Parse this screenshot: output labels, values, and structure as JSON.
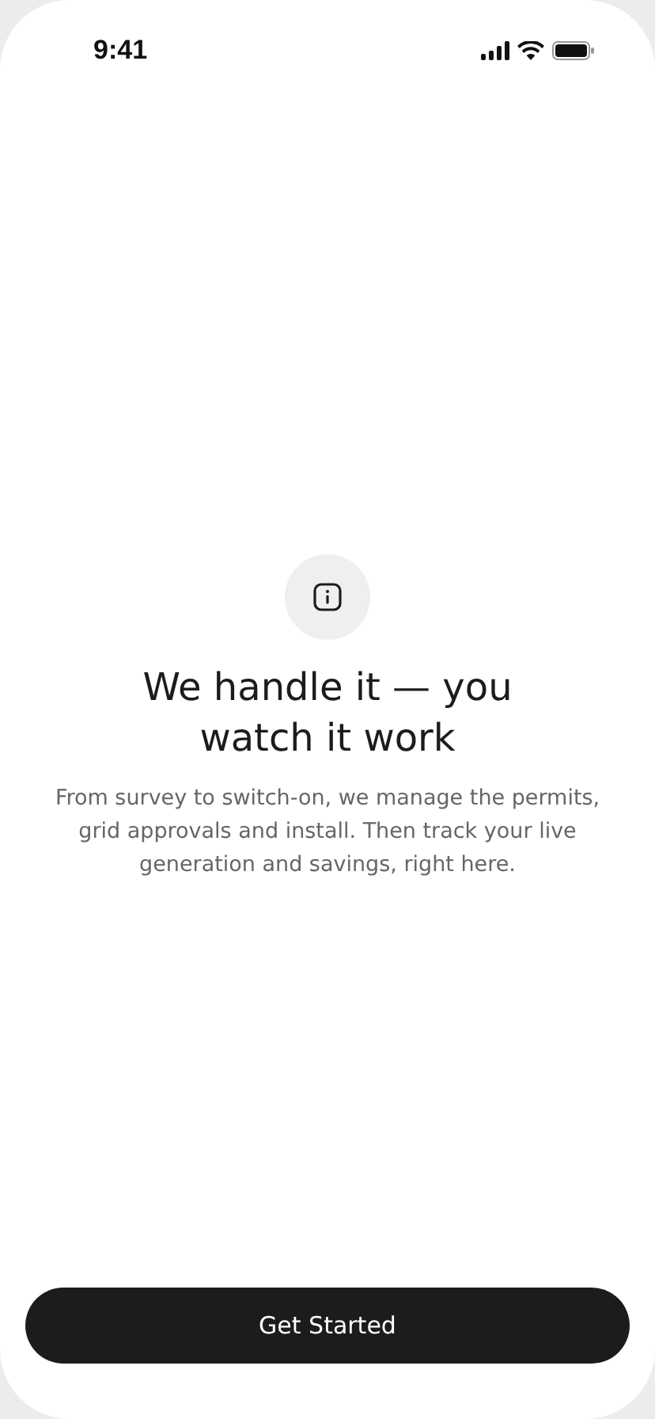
{
  "status_bar": {
    "time": "9:41"
  },
  "content": {
    "title": "We handle it — you watch it work",
    "body": "From survey to switch-on, we manage the permits, grid approvals and install. Then track your live generation and savings, right here."
  },
  "button": {
    "label": "Get Started"
  }
}
